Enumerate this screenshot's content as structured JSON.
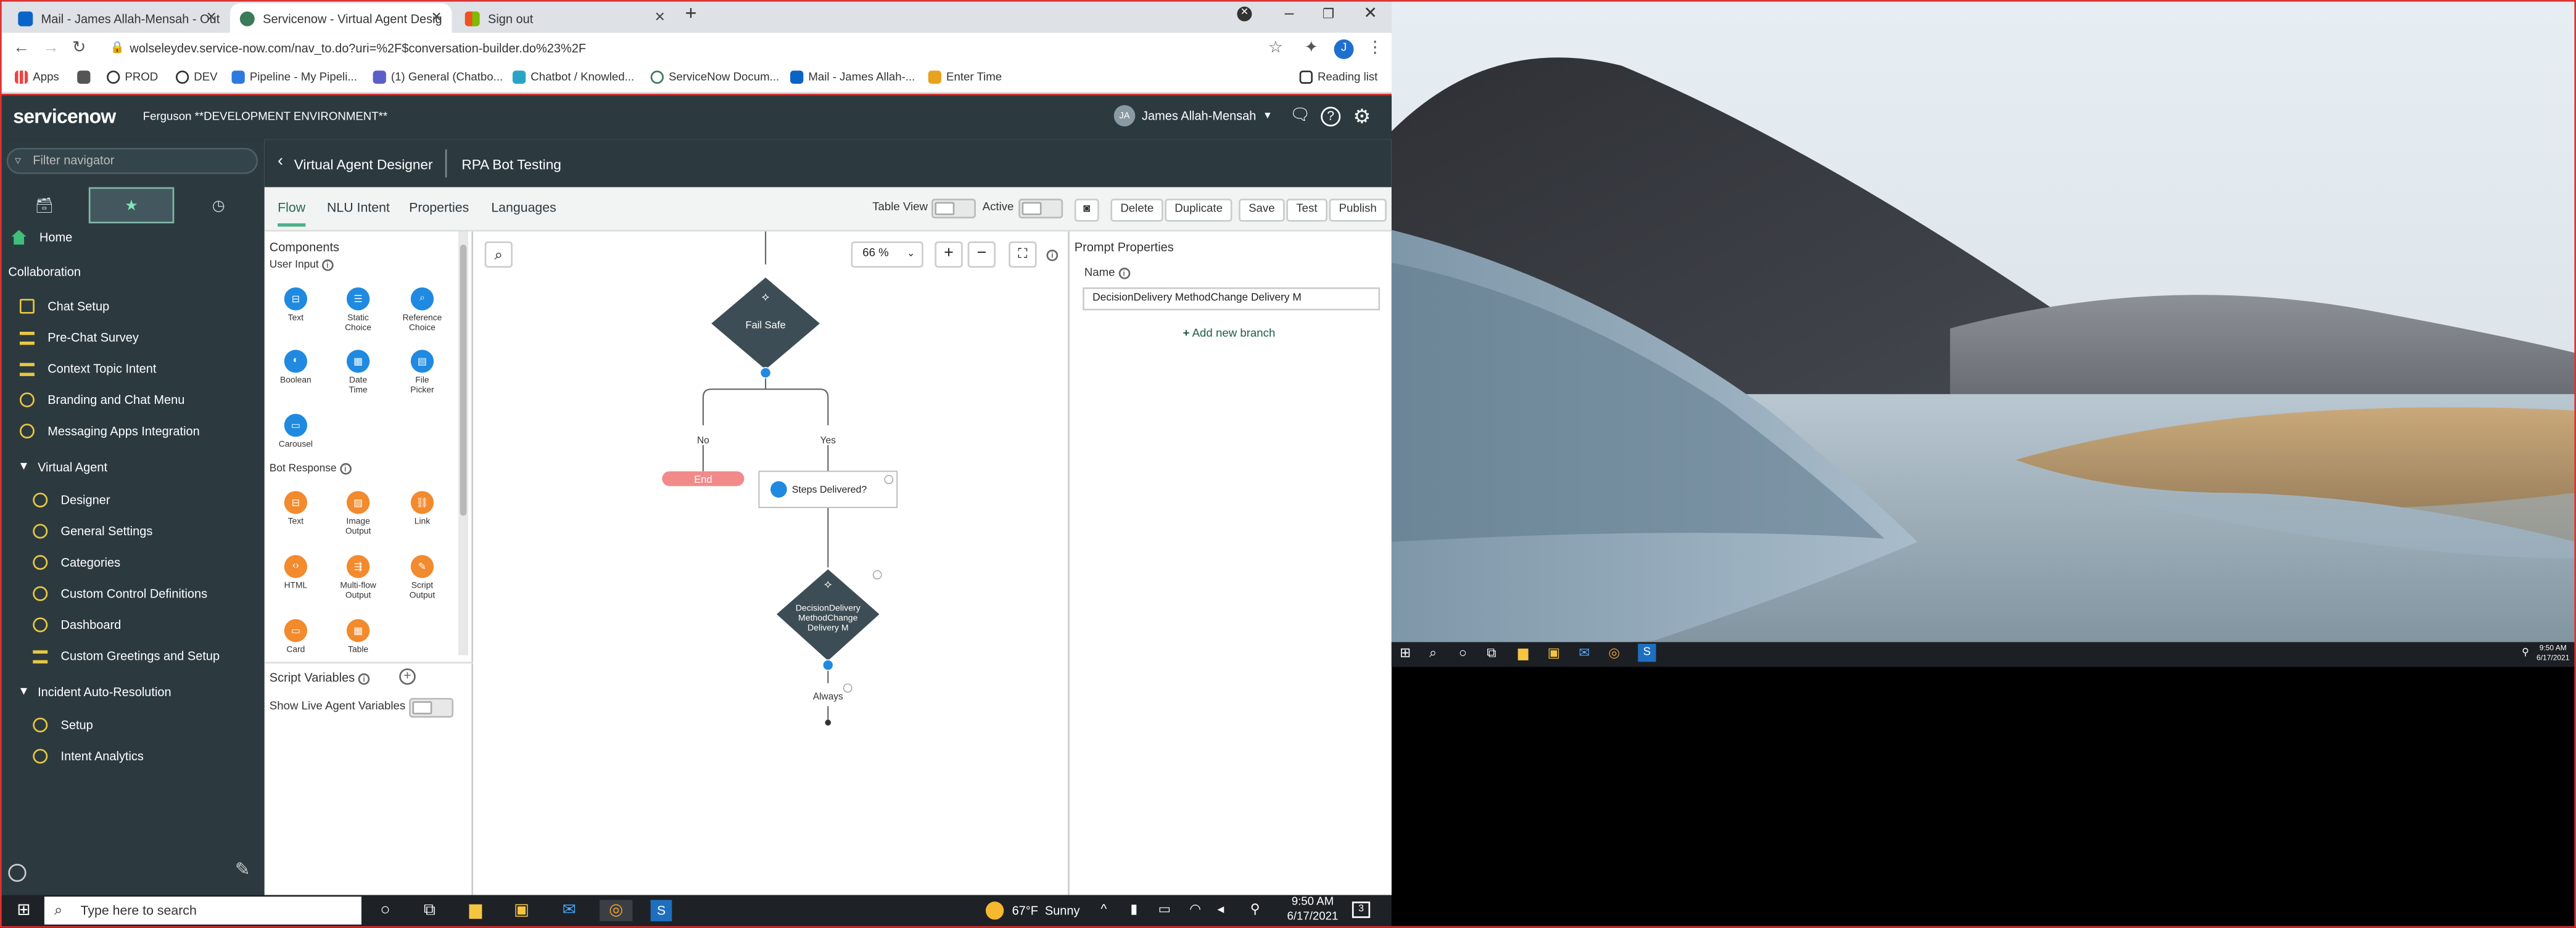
{
  "browser": {
    "tabs": [
      {
        "title": "Mail - James Allah-Mensah - Out",
        "active": false
      },
      {
        "title": "Servicenow - Virtual Agent Desig",
        "active": true
      },
      {
        "title": "Sign out",
        "active": false
      }
    ],
    "url": "wolseleydev.service-now.com/nav_to.do?uri=%2F$conversation-builder.do%23%2F",
    "profile_initial": "J",
    "bookmarks": [
      "Apps",
      "PROD",
      "DEV",
      "Pipeline - My Pipeli...",
      "(1) General (Chatbo...",
      "Chatbot / Knowled...",
      "ServiceNow Docum...",
      "Mail - James Allah-...",
      "Enter Time"
    ],
    "reading_list": "Reading list"
  },
  "sn_header": {
    "logo": "servicenow",
    "instance": "Ferguson **DEVELOPMENT ENVIRONMENT**",
    "user_initials": "JA",
    "user_name": "James Allah-Mensah"
  },
  "left_nav": {
    "filter_placeholder": "Filter navigator",
    "home": "Home",
    "collaboration": "Collaboration",
    "items": [
      {
        "label": "Chat Setup",
        "icon": "book"
      },
      {
        "label": "Pre-Chat Survey",
        "icon": "list"
      },
      {
        "label": "Context Topic Intent",
        "icon": "list"
      },
      {
        "label": "Branding and Chat Menu",
        "icon": "info"
      },
      {
        "label": "Messaging Apps Integration",
        "icon": "info"
      }
    ],
    "virtual_agent": "Virtual Agent",
    "va_items": [
      "Designer",
      "General Settings",
      "Categories",
      "Custom Control Definitions",
      "Dashboard",
      "Custom Greetings and Setup"
    ],
    "incident": "Incident Auto-Resolution",
    "incident_items": [
      "Setup",
      "Intent Analytics"
    ]
  },
  "designer": {
    "back_title": "Virtual Agent Designer",
    "topic": "RPA Bot Testing",
    "tabs": [
      "Flow",
      "NLU Intent",
      "Properties",
      "Languages"
    ],
    "table_view": "Table View",
    "active": "Active",
    "buttons": [
      "Delete",
      "Duplicate",
      "Save",
      "Test",
      "Publish"
    ]
  },
  "components": {
    "title": "Components",
    "user_input": "User Input",
    "user_input_items": [
      "Text",
      "Static Choice",
      "Reference Choice",
      "Boolean",
      "Date Time",
      "File Picker",
      "Carousel"
    ],
    "bot_response": "Bot Response",
    "bot_response_items": [
      "Text",
      "Image Output",
      "Link",
      "HTML",
      "Multi-flow Output",
      "Script Output",
      "Card",
      "Table"
    ],
    "script_variables": "Script Variables",
    "show_live": "Show Live Agent Variables"
  },
  "canvas": {
    "zoom": "66 %",
    "fail_safe": "Fail Safe",
    "no": "No",
    "yes": "Yes",
    "end": "End",
    "steps_delivered": "Steps Delivered?",
    "decision": "DecisionDelivery MethodChange Delivery M",
    "always": "Always"
  },
  "prompt_properties": {
    "title": "Prompt Properties",
    "name_label": "Name",
    "name_value": "DecisionDelivery MethodChange Delivery M",
    "add_branch": "Add new branch"
  },
  "taskbar": {
    "search_placeholder": "Type here to search",
    "weather_temp": "67°F",
    "weather_text": "Sunny",
    "time": "9:50 AM",
    "date": "6/17/2021",
    "notif_count": "3"
  },
  "remote_taskbar": {
    "time": "9:50 AM",
    "date": "6/17/2021"
  },
  "colors": {
    "sn_dark": "#2c3a40",
    "accent_green": "#4ab08a",
    "node_dark": "#3d4d55",
    "end_red": "#f28a8a",
    "comp_blue": "#1f8ae0",
    "comp_orange": "#f28a2e"
  }
}
